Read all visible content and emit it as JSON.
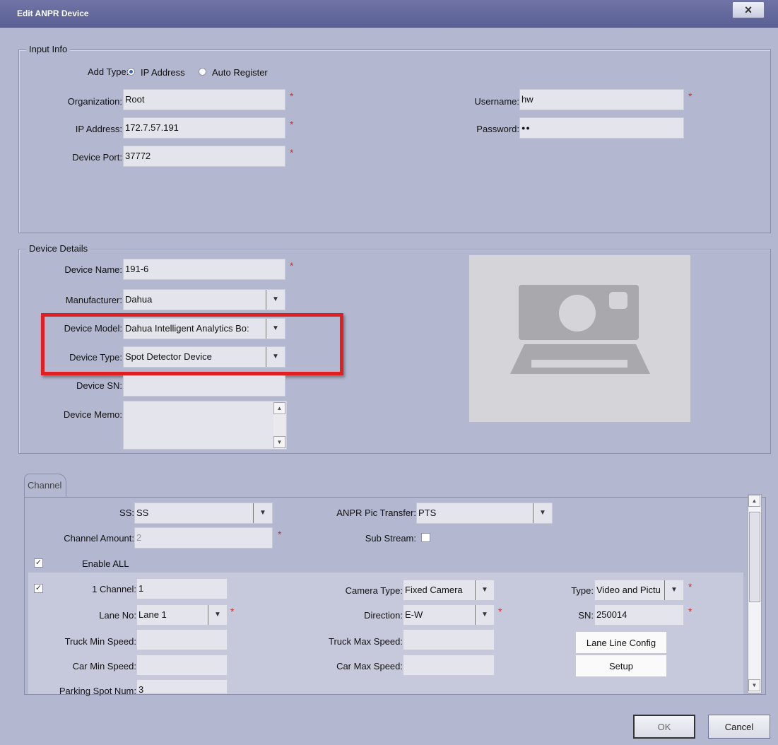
{
  "window": {
    "title": "Edit ANPR Device",
    "close_glyph": "×"
  },
  "input_info": {
    "legend": "Input Info",
    "add_type_label": "Add Type:",
    "ip_option": "IP Address",
    "auto_option": "Auto Register",
    "organization_label": "Organization:",
    "organization_value": "Root",
    "ip_label": "IP Address:",
    "ip_value": "172.7.57.191",
    "port_label": "Device Port:",
    "port_value": "37772",
    "username_label": "Username:",
    "username_value": "hw",
    "password_label": "Password:",
    "password_value": "●●",
    "required_mark": "*"
  },
  "device_details": {
    "legend": "Device Details",
    "name_label": "Device Name:",
    "name_value": "191-6",
    "manufacturer_label": "Manufacturer:",
    "manufacturer_value": "Dahua",
    "model_label": "Device Model:",
    "model_value": "Dahua Intelligent Analytics Bo:",
    "type_label": "Device Type:",
    "type_value": "Spot Detector Device",
    "sn_label": "Device SN:",
    "sn_value": "",
    "memo_label": "Device Memo:",
    "memo_value": ""
  },
  "channel": {
    "tab": "Channel",
    "ss_label": "SS:",
    "ss_value": "SS",
    "pic_transfer_label": "ANPR Pic Transfer:",
    "pic_transfer_value": "PTS",
    "amount_label": "Channel Amount:",
    "amount_value": "2",
    "sub_stream_label": "Sub Stream:",
    "enable_all_label": "Enable ALL",
    "check_glyph": "✓",
    "row": {
      "channel_label": "1 Channel:",
      "channel_value": "1",
      "camera_type_label": "Camera Type:",
      "camera_type_value": "Fixed Camera",
      "type_label": "Type:",
      "type_value": "Video and Pictu",
      "lane_label": "Lane No:",
      "lane_value": "Lane 1",
      "direction_label": "Direction:",
      "direction_value": "E-W",
      "sn_label": "SN:",
      "sn_value": "250014",
      "truck_min_label": "Truck Min Speed:",
      "truck_max_label": "Truck Max Speed:",
      "car_min_label": "Car Min Speed:",
      "car_max_label": "Car Max Speed:",
      "lane_config_btn": "Lane Line Config",
      "setup_btn": "Setup",
      "parking_label": "Parking Spot Num:",
      "parking_value": "3"
    }
  },
  "footer": {
    "ok": "OK",
    "cancel": "Cancel"
  },
  "icons": {
    "dropdown": "▼",
    "scroll_up": "▲",
    "scroll_down": "▼"
  },
  "colors": {
    "titlebar": "#5f6499",
    "body": "#b3b7cf",
    "required": "#d03030",
    "highlight_border": "#e02020"
  }
}
